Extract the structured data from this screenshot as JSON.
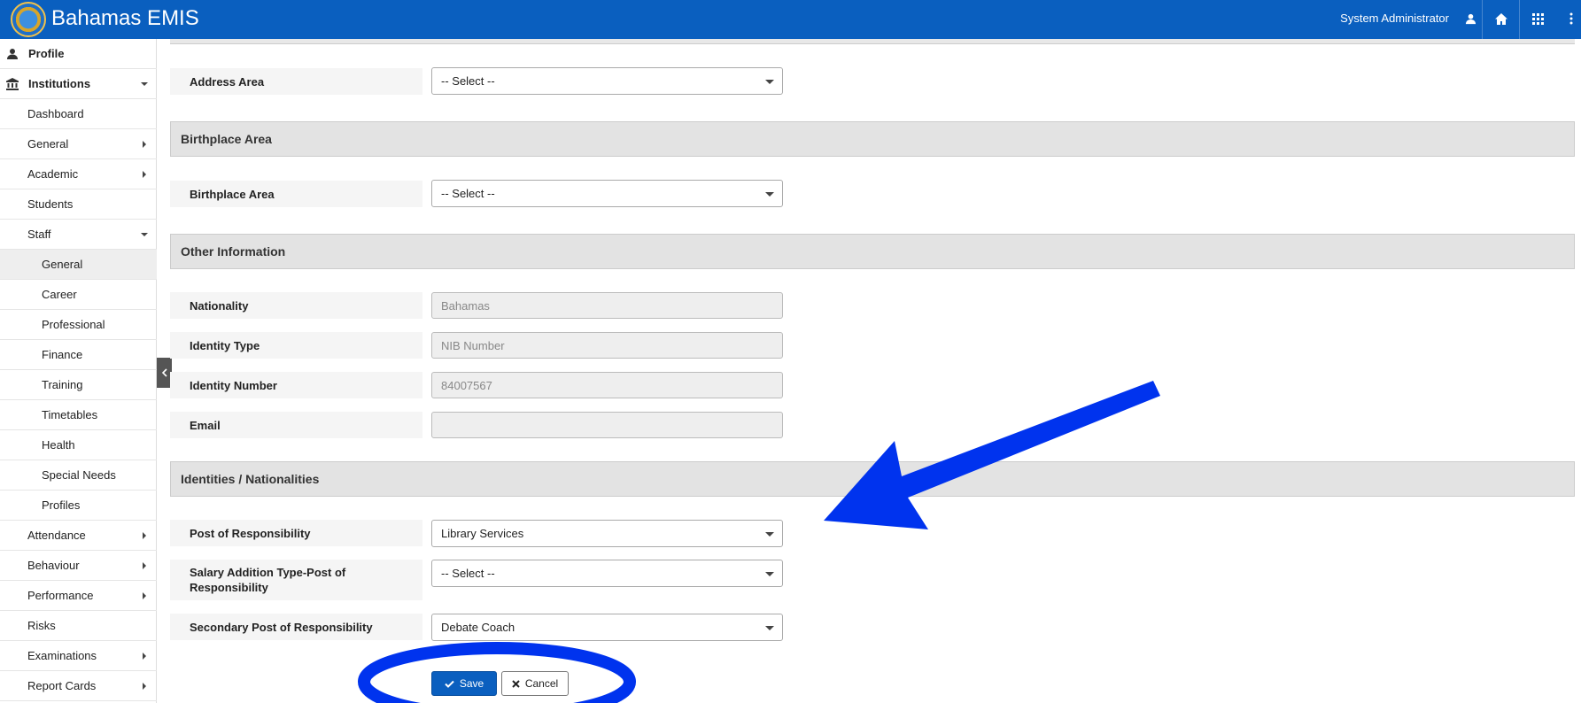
{
  "header": {
    "app_title": "Bahamas EMIS",
    "user_name": "System Administrator"
  },
  "sidebar": {
    "items": [
      {
        "label": "Profile"
      },
      {
        "label": "Institutions"
      },
      {
        "label": "Dashboard"
      },
      {
        "label": "General"
      },
      {
        "label": "Academic"
      },
      {
        "label": "Students"
      },
      {
        "label": "Staff"
      },
      {
        "label": "General"
      },
      {
        "label": "Career"
      },
      {
        "label": "Professional"
      },
      {
        "label": "Finance"
      },
      {
        "label": "Training"
      },
      {
        "label": "Timetables"
      },
      {
        "label": "Health"
      },
      {
        "label": "Special Needs"
      },
      {
        "label": "Profiles"
      },
      {
        "label": "Attendance"
      },
      {
        "label": "Behaviour"
      },
      {
        "label": "Performance"
      },
      {
        "label": "Risks"
      },
      {
        "label": "Examinations"
      },
      {
        "label": "Report Cards"
      }
    ]
  },
  "form": {
    "address_area": {
      "label": "Address Area",
      "value": "-- Select --"
    },
    "birthplace_section": "Birthplace Area",
    "birthplace_area": {
      "label": "Birthplace Area",
      "value": "-- Select --"
    },
    "other_section": "Other Information",
    "nationality": {
      "label": "Nationality",
      "value": "Bahamas"
    },
    "identity_type": {
      "label": "Identity Type",
      "value": "NIB Number"
    },
    "identity_number": {
      "label": "Identity Number",
      "value": "84007567"
    },
    "email": {
      "label": "Email",
      "value": ""
    },
    "identities_section": "Identities / Nationalities",
    "post_of_responsibility": {
      "label": "Post of Responsibility",
      "value": "Library Services"
    },
    "salary_addition": {
      "label": "Salary Addition Type-Post of Responsibility",
      "value": "-- Select --"
    },
    "secondary_post": {
      "label": "Secondary Post of Responsibility",
      "value": "Debate Coach"
    }
  },
  "actions": {
    "save_label": "Save",
    "cancel_label": "Cancel"
  },
  "colors": {
    "header_bg": "#0a5fbf",
    "annotation": "#0033ee"
  },
  "icons": [
    "user-icon",
    "bank-icon",
    "home-icon",
    "grid-icon",
    "more-vertical-icon",
    "chevron-left-icon",
    "check-icon",
    "times-icon"
  ]
}
